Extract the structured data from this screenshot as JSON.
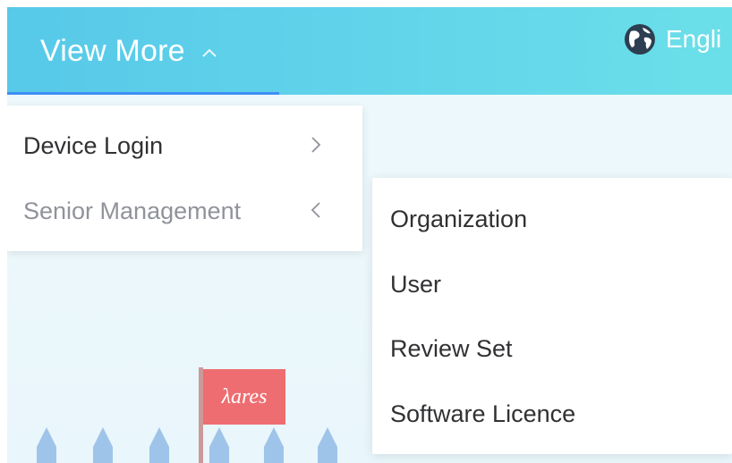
{
  "header": {
    "view_more_label": "View More",
    "language_label": "Engli"
  },
  "menu": {
    "items": [
      {
        "label": "Device Login",
        "arrow": "chevron-right-icon"
      },
      {
        "label": "Senior Management",
        "arrow": "chevron-left-icon"
      }
    ]
  },
  "submenu": {
    "items": [
      {
        "label": "Organization"
      },
      {
        "label": "User"
      },
      {
        "label": "Review Set"
      },
      {
        "label": "Software Licence"
      }
    ]
  },
  "illustration": {
    "flag_text": "λares"
  },
  "colors": {
    "header_start": "#57c9e9",
    "header_end": "#6bdfe9",
    "active_underline": "#3d8ff3",
    "text_primary": "#303133",
    "text_muted": "#909399",
    "flag": "#ee6d70"
  }
}
